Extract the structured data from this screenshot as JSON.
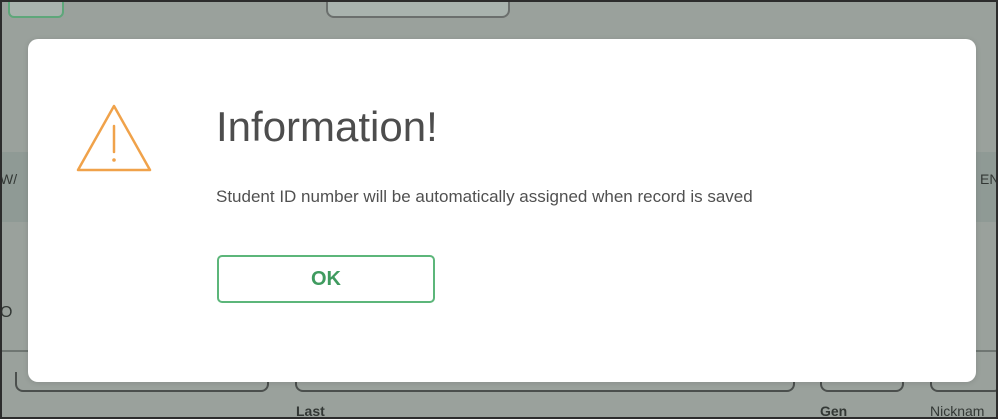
{
  "dialog": {
    "title": "Information!",
    "message": "Student ID number will be automatically assigned when record is saved",
    "ok_label": "OK",
    "icon": "warning-icon",
    "icon_color": "#f0a24a",
    "accent_color": "#5cb67a"
  },
  "background": {
    "left_header_fragment": "W/",
    "right_header_fragment": "EN",
    "left_label_fragment": "O",
    "field_labels": {
      "last": "Last",
      "gen": "Gen",
      "nickname": "Nicknam"
    }
  }
}
